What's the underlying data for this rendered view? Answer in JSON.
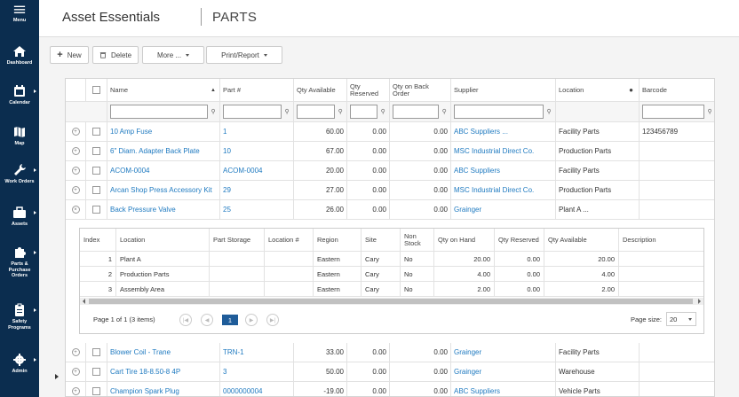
{
  "sidebar": {
    "menu_label": "Menu",
    "items": [
      {
        "label": "Dashboard",
        "icon": "home-icon"
      },
      {
        "label": "Calendar",
        "icon": "calendar-icon"
      },
      {
        "label": "Map",
        "icon": "map-icon"
      },
      {
        "label": "Work Orders",
        "icon": "wrench-icon"
      },
      {
        "label": "Assets",
        "icon": "briefcase-icon"
      },
      {
        "label_lines": [
          "Parts &",
          "Purchase",
          "Orders"
        ],
        "icon": "puzzle-icon"
      },
      {
        "label_lines": [
          "Safety",
          "Programs"
        ],
        "icon": "clipboard-icon"
      },
      {
        "label": "Admin",
        "icon": "gear-icon"
      }
    ]
  },
  "header": {
    "app_title": "Asset Essentials",
    "page_title": "PARTS"
  },
  "toolbar": {
    "new_label": "New",
    "delete_label": "Delete",
    "more_label": "More ...",
    "print_label": "Print/Report"
  },
  "grid": {
    "columns": {
      "name": "Name",
      "part": "Part #",
      "qty_available": "Qty Available",
      "qty_reserved": "Qty Reserved",
      "qty_backorder": "Qty on Back Order",
      "supplier": "Supplier",
      "location": "Location",
      "barcode": "Barcode"
    },
    "rows": [
      {
        "name": "10 Amp Fuse",
        "part": "1",
        "qty_available": "60.00",
        "qty_reserved": "0.00",
        "qty_backorder": "0.00",
        "supplier": "ABC Suppliers ...",
        "location": "Facility Parts",
        "barcode": "123456789"
      },
      {
        "name": "6\" Diam. Adapter Back Plate",
        "part": "10",
        "qty_available": "67.00",
        "qty_reserved": "0.00",
        "qty_backorder": "0.00",
        "supplier": "MSC Industrial Direct Co.",
        "location": "Production Parts",
        "barcode": ""
      },
      {
        "name": "ACOM-0004",
        "part": "ACOM-0004",
        "qty_available": "20.00",
        "qty_reserved": "0.00",
        "qty_backorder": "0.00",
        "supplier": "ABC Suppliers",
        "location": "Facility Parts",
        "barcode": ""
      },
      {
        "name": "Arcan Shop Press Accessory Kit",
        "part": "29",
        "qty_available": "27.00",
        "qty_reserved": "0.00",
        "qty_backorder": "0.00",
        "supplier": "MSC Industrial Direct Co.",
        "location": "Production Parts",
        "barcode": ""
      },
      {
        "name": "Back Pressure Valve",
        "part": "25",
        "qty_available": "26.00",
        "qty_reserved": "0.00",
        "qty_backorder": "0.00",
        "supplier": "Grainger",
        "location": "Plant A ...",
        "barcode": ""
      }
    ],
    "rows_after": [
      {
        "name": "Blower Coil - Trane",
        "part": "TRN-1",
        "qty_available": "33.00",
        "qty_reserved": "0.00",
        "qty_backorder": "0.00",
        "supplier": "Grainger",
        "location": "Facility Parts",
        "barcode": ""
      },
      {
        "name": "Cart Tire 18-8.50-8 4P",
        "part": "3",
        "qty_available": "50.00",
        "qty_reserved": "0.00",
        "qty_backorder": "0.00",
        "supplier": "Grainger",
        "location": "Warehouse",
        "barcode": ""
      },
      {
        "name": "Champion Spark Plug",
        "part": "0000000004",
        "qty_available": "-19.00",
        "qty_reserved": "0.00",
        "qty_backorder": "0.00",
        "supplier": "ABC Suppliers",
        "location": "Vehicle Parts",
        "barcode": ""
      }
    ]
  },
  "detail": {
    "columns": {
      "index": "Index",
      "location": "Location",
      "part_storage": "Part Storage",
      "location_no": "Location #",
      "region": "Region",
      "site": "Site",
      "non_stock": "Non Stock",
      "qty_on_hand": "Qty on Hand",
      "qty_reserved": "Qty Reserved",
      "qty_available": "Qty Available",
      "description": "Description"
    },
    "rows": [
      {
        "index": "1",
        "location": "Plant A",
        "region": "Eastern",
        "site": "Cary",
        "non_stock": "No",
        "qty_on_hand": "20.00",
        "qty_reserved": "0.00",
        "qty_available": "20.00"
      },
      {
        "index": "2",
        "location": "Production Parts",
        "region": "Eastern",
        "site": "Cary",
        "non_stock": "No",
        "qty_on_hand": "4.00",
        "qty_reserved": "0.00",
        "qty_available": "4.00"
      },
      {
        "index": "3",
        "location": "Assembly Area",
        "region": "Eastern",
        "site": "Cary",
        "non_stock": "No",
        "qty_on_hand": "2.00",
        "qty_reserved": "0.00",
        "qty_available": "2.00"
      }
    ],
    "pager_text": "Page 1 of 1 (3 items)",
    "current_page": "1",
    "page_size_label": "Page size:",
    "page_size": "20"
  },
  "colors": {
    "sidebar_bg": "#0b2d4f",
    "link": "#1f7ac0",
    "pager_active": "#1f5c99"
  }
}
